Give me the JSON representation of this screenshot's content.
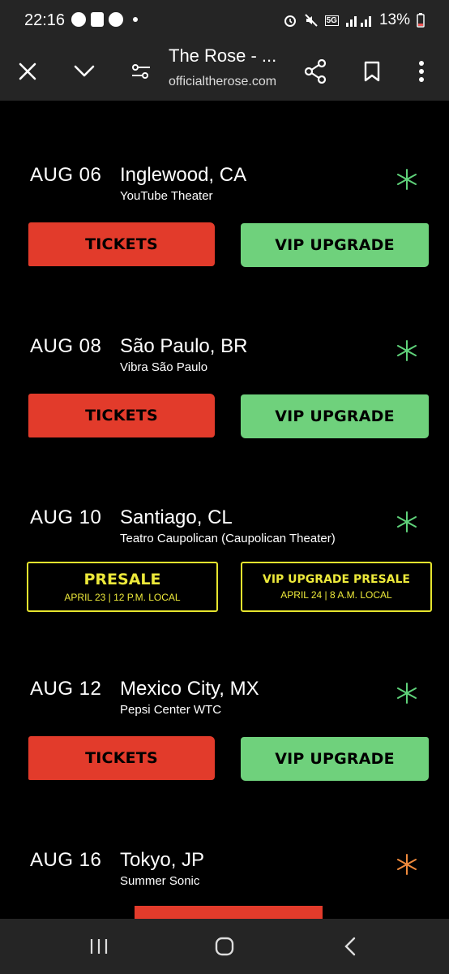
{
  "status": {
    "time": "22:16",
    "battery": "13%",
    "net": "5G"
  },
  "browser": {
    "title": "The Rose - ...",
    "url": "officialtherose.com"
  },
  "events": [
    {
      "date": "AUG 06",
      "city": "Inglewood, CA",
      "venue": "YouTube Theater",
      "left": {
        "label": "TICKETS"
      },
      "right": {
        "label": "VIP UPGRADE"
      }
    },
    {
      "date": "AUG 08",
      "city": "São Paulo, BR",
      "venue": "Vibra São Paulo",
      "left": {
        "label": "TICKETS"
      },
      "right": {
        "label": "VIP UPGRADE"
      }
    },
    {
      "date": "AUG 10",
      "city": "Santiago, CL",
      "venue": "Teatro Caupolican (Caupolican Theater)",
      "left": {
        "label": "PRESALE",
        "sub": "APRIL 23 | 12 P.M. LOCAL"
      },
      "right": {
        "label": "VIP UPGRADE PRESALE",
        "sub": "APRIL 24 | 8 A.M. LOCAL"
      }
    },
    {
      "date": "AUG 12",
      "city": "Mexico City, MX",
      "venue": "Pepsi Center WTC",
      "left": {
        "label": "TICKETS"
      },
      "right": {
        "label": "VIP UPGRADE"
      }
    },
    {
      "date": "AUG 16",
      "city": "Tokyo, JP",
      "venue": "Summer Sonic"
    }
  ],
  "colors": {
    "red": "#e23b2b",
    "green": "#6fd17c",
    "yellow": "#ede93a",
    "star_green": "#5fd27a",
    "star_orange": "#f08a3c",
    "bar": "#252525"
  }
}
